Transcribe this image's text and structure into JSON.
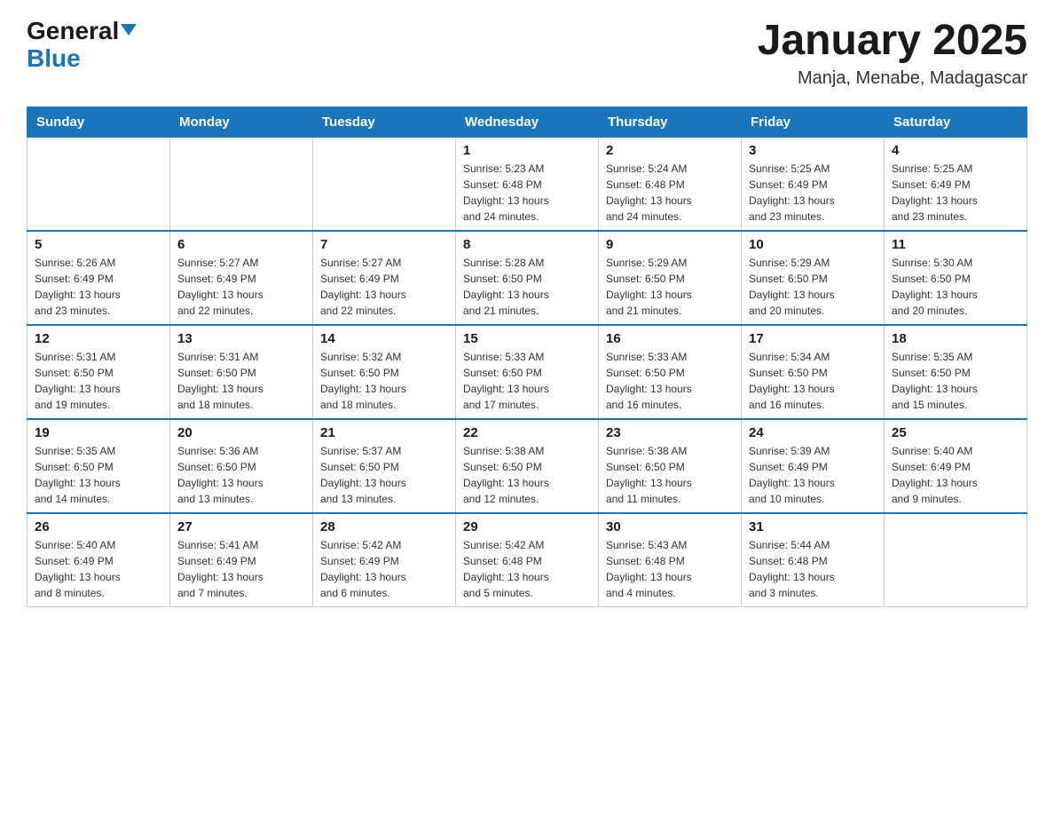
{
  "logo": {
    "text_general": "General",
    "text_blue": "Blue"
  },
  "header": {
    "month_title": "January 2025",
    "location": "Manja, Menabe, Madagascar"
  },
  "weekdays": [
    "Sunday",
    "Monday",
    "Tuesday",
    "Wednesday",
    "Thursday",
    "Friday",
    "Saturday"
  ],
  "weeks": [
    [
      {
        "day": "",
        "info": ""
      },
      {
        "day": "",
        "info": ""
      },
      {
        "day": "",
        "info": ""
      },
      {
        "day": "1",
        "info": "Sunrise: 5:23 AM\nSunset: 6:48 PM\nDaylight: 13 hours\nand 24 minutes."
      },
      {
        "day": "2",
        "info": "Sunrise: 5:24 AM\nSunset: 6:48 PM\nDaylight: 13 hours\nand 24 minutes."
      },
      {
        "day": "3",
        "info": "Sunrise: 5:25 AM\nSunset: 6:49 PM\nDaylight: 13 hours\nand 23 minutes."
      },
      {
        "day": "4",
        "info": "Sunrise: 5:25 AM\nSunset: 6:49 PM\nDaylight: 13 hours\nand 23 minutes."
      }
    ],
    [
      {
        "day": "5",
        "info": "Sunrise: 5:26 AM\nSunset: 6:49 PM\nDaylight: 13 hours\nand 23 minutes."
      },
      {
        "day": "6",
        "info": "Sunrise: 5:27 AM\nSunset: 6:49 PM\nDaylight: 13 hours\nand 22 minutes."
      },
      {
        "day": "7",
        "info": "Sunrise: 5:27 AM\nSunset: 6:49 PM\nDaylight: 13 hours\nand 22 minutes."
      },
      {
        "day": "8",
        "info": "Sunrise: 5:28 AM\nSunset: 6:50 PM\nDaylight: 13 hours\nand 21 minutes."
      },
      {
        "day": "9",
        "info": "Sunrise: 5:29 AM\nSunset: 6:50 PM\nDaylight: 13 hours\nand 21 minutes."
      },
      {
        "day": "10",
        "info": "Sunrise: 5:29 AM\nSunset: 6:50 PM\nDaylight: 13 hours\nand 20 minutes."
      },
      {
        "day": "11",
        "info": "Sunrise: 5:30 AM\nSunset: 6:50 PM\nDaylight: 13 hours\nand 20 minutes."
      }
    ],
    [
      {
        "day": "12",
        "info": "Sunrise: 5:31 AM\nSunset: 6:50 PM\nDaylight: 13 hours\nand 19 minutes."
      },
      {
        "day": "13",
        "info": "Sunrise: 5:31 AM\nSunset: 6:50 PM\nDaylight: 13 hours\nand 18 minutes."
      },
      {
        "day": "14",
        "info": "Sunrise: 5:32 AM\nSunset: 6:50 PM\nDaylight: 13 hours\nand 18 minutes."
      },
      {
        "day": "15",
        "info": "Sunrise: 5:33 AM\nSunset: 6:50 PM\nDaylight: 13 hours\nand 17 minutes."
      },
      {
        "day": "16",
        "info": "Sunrise: 5:33 AM\nSunset: 6:50 PM\nDaylight: 13 hours\nand 16 minutes."
      },
      {
        "day": "17",
        "info": "Sunrise: 5:34 AM\nSunset: 6:50 PM\nDaylight: 13 hours\nand 16 minutes."
      },
      {
        "day": "18",
        "info": "Sunrise: 5:35 AM\nSunset: 6:50 PM\nDaylight: 13 hours\nand 15 minutes."
      }
    ],
    [
      {
        "day": "19",
        "info": "Sunrise: 5:35 AM\nSunset: 6:50 PM\nDaylight: 13 hours\nand 14 minutes."
      },
      {
        "day": "20",
        "info": "Sunrise: 5:36 AM\nSunset: 6:50 PM\nDaylight: 13 hours\nand 13 minutes."
      },
      {
        "day": "21",
        "info": "Sunrise: 5:37 AM\nSunset: 6:50 PM\nDaylight: 13 hours\nand 13 minutes."
      },
      {
        "day": "22",
        "info": "Sunrise: 5:38 AM\nSunset: 6:50 PM\nDaylight: 13 hours\nand 12 minutes."
      },
      {
        "day": "23",
        "info": "Sunrise: 5:38 AM\nSunset: 6:50 PM\nDaylight: 13 hours\nand 11 minutes."
      },
      {
        "day": "24",
        "info": "Sunrise: 5:39 AM\nSunset: 6:49 PM\nDaylight: 13 hours\nand 10 minutes."
      },
      {
        "day": "25",
        "info": "Sunrise: 5:40 AM\nSunset: 6:49 PM\nDaylight: 13 hours\nand 9 minutes."
      }
    ],
    [
      {
        "day": "26",
        "info": "Sunrise: 5:40 AM\nSunset: 6:49 PM\nDaylight: 13 hours\nand 8 minutes."
      },
      {
        "day": "27",
        "info": "Sunrise: 5:41 AM\nSunset: 6:49 PM\nDaylight: 13 hours\nand 7 minutes."
      },
      {
        "day": "28",
        "info": "Sunrise: 5:42 AM\nSunset: 6:49 PM\nDaylight: 13 hours\nand 6 minutes."
      },
      {
        "day": "29",
        "info": "Sunrise: 5:42 AM\nSunset: 6:48 PM\nDaylight: 13 hours\nand 5 minutes."
      },
      {
        "day": "30",
        "info": "Sunrise: 5:43 AM\nSunset: 6:48 PM\nDaylight: 13 hours\nand 4 minutes."
      },
      {
        "day": "31",
        "info": "Sunrise: 5:44 AM\nSunset: 6:48 PM\nDaylight: 13 hours\nand 3 minutes."
      },
      {
        "day": "",
        "info": ""
      }
    ]
  ]
}
